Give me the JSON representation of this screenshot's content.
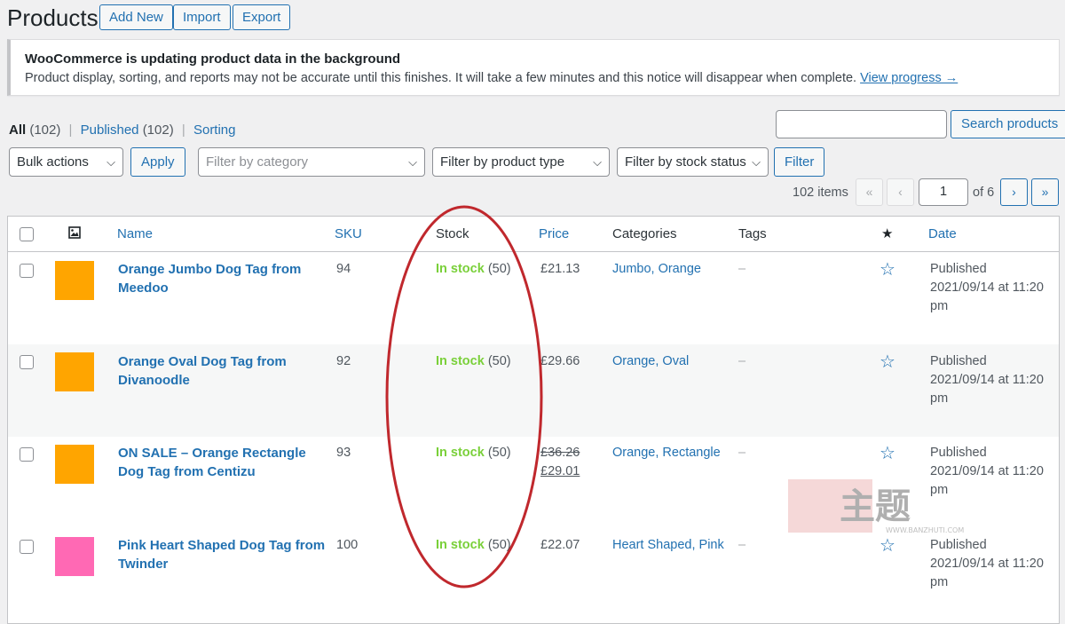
{
  "header": {
    "title": "Products",
    "add_new": "Add New",
    "import": "Import",
    "export": "Export"
  },
  "notice": {
    "title": "WooCommerce is updating product data in the background",
    "message": "Product display, sorting, and reports may not be accurate until this finishes. It will take a few minutes and this notice will disappear when complete.",
    "link": "View progress →"
  },
  "views": {
    "all": "All",
    "all_count": "(102)",
    "published": "Published",
    "published_count": "(102)",
    "sorting": "Sorting",
    "sep": "|"
  },
  "search": {
    "value": "",
    "button": "Search products"
  },
  "filters": {
    "bulk_actions": "Bulk actions",
    "apply": "Apply",
    "category": "Filter by category",
    "product_type": "Filter by product type",
    "stock_status": "Filter by stock status",
    "filter": "Filter",
    "chevron": "⌵"
  },
  "pagination": {
    "items": "102 items",
    "first": "«",
    "prev": "‹",
    "current": "1",
    "of": "of 6",
    "next": "›",
    "last": "»"
  },
  "columns": {
    "name": "Name",
    "sku": "SKU",
    "stock": "Stock",
    "price": "Price",
    "categories": "Categories",
    "tags": "Tags",
    "featured": "★",
    "date": "Date"
  },
  "rows": [
    {
      "name": "Orange Jumbo Dog Tag from Meedoo",
      "sku": "94",
      "stock_label": "In stock",
      "stock_qty": "(50)",
      "price": "£21.13",
      "categories": "Jumbo, Orange",
      "tags": "–",
      "date_status": "Published",
      "date_value": "2021/09/14 at 11:20 pm",
      "thumb_color": "#ffa500"
    },
    {
      "name": "Orange Oval Dog Tag from Divanoodle",
      "sku": "92",
      "stock_label": "In stock",
      "stock_qty": "(50)",
      "price": "£29.66",
      "categories": "Orange, Oval",
      "tags": "–",
      "date_status": "Published",
      "date_value": "2021/09/14 at 11:20 pm",
      "thumb_color": "#ffa500"
    },
    {
      "name": "ON SALE – Orange Rectangle Dog Tag from Centizu",
      "sku": "93",
      "stock_label": "In stock",
      "stock_qty": "(50)",
      "price_old": "£36.26",
      "price": "£29.01",
      "categories": "Orange, Rectangle",
      "tags": "–",
      "date_status": "Published",
      "date_value": "2021/09/14 at 11:20 pm",
      "thumb_color": "#ffa500"
    },
    {
      "name": "Pink Heart Shaped Dog Tag from Twinder",
      "sku": "100",
      "stock_label": "In stock",
      "stock_qty": "(50)",
      "price": "£22.07",
      "categories": "Heart Shaped, Pink",
      "tags": "–",
      "date_status": "Published",
      "date_value": "2021/09/14 at 11:20 pm",
      "thumb_color": "#ff69b4"
    }
  ],
  "icons": {
    "image_column": "image-icon",
    "featured": "star-outline-icon"
  },
  "colors": {
    "link": "#2271b1",
    "in_stock": "#7ad03a",
    "annotation": "#c0282d"
  },
  "watermark": {
    "text": "主题",
    "url": "WWW.BANZHUTI.COM"
  }
}
